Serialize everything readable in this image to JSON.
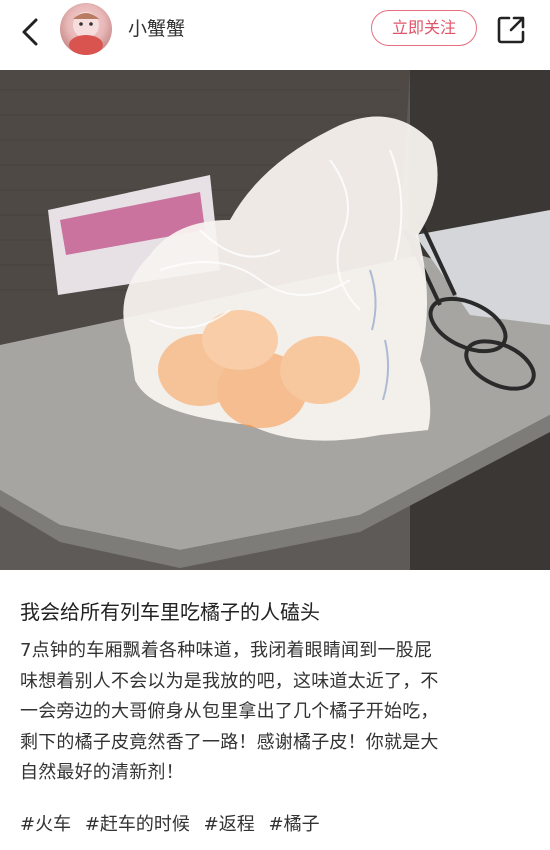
{
  "header": {
    "back_icon": "back-arrow-icon",
    "username": "小蟹蟹",
    "follow_label": "立即关注",
    "share_icon": "share-icon",
    "accent_color": "#e05468"
  },
  "post": {
    "image_subject": "bag of oranges on train tray table",
    "title": "我会给所有列车里吃橘子的人磕头",
    "body_lines": [
      "7点钟的车厢飘着各种味道，我闭着眼睛闻到一股屁",
      "味想着别人不会以为是我放的吧，这味道太近了，不",
      "一会旁边的大哥俯身从包里拿出了几个橘子开始吃，",
      "剩下的橘子皮竟然香了一路！感谢橘子皮！你就是大",
      "自然最好的清新剂！"
    ],
    "tags": [
      "#火车",
      "#赶车的时候",
      "#返程",
      "#橘子"
    ]
  }
}
